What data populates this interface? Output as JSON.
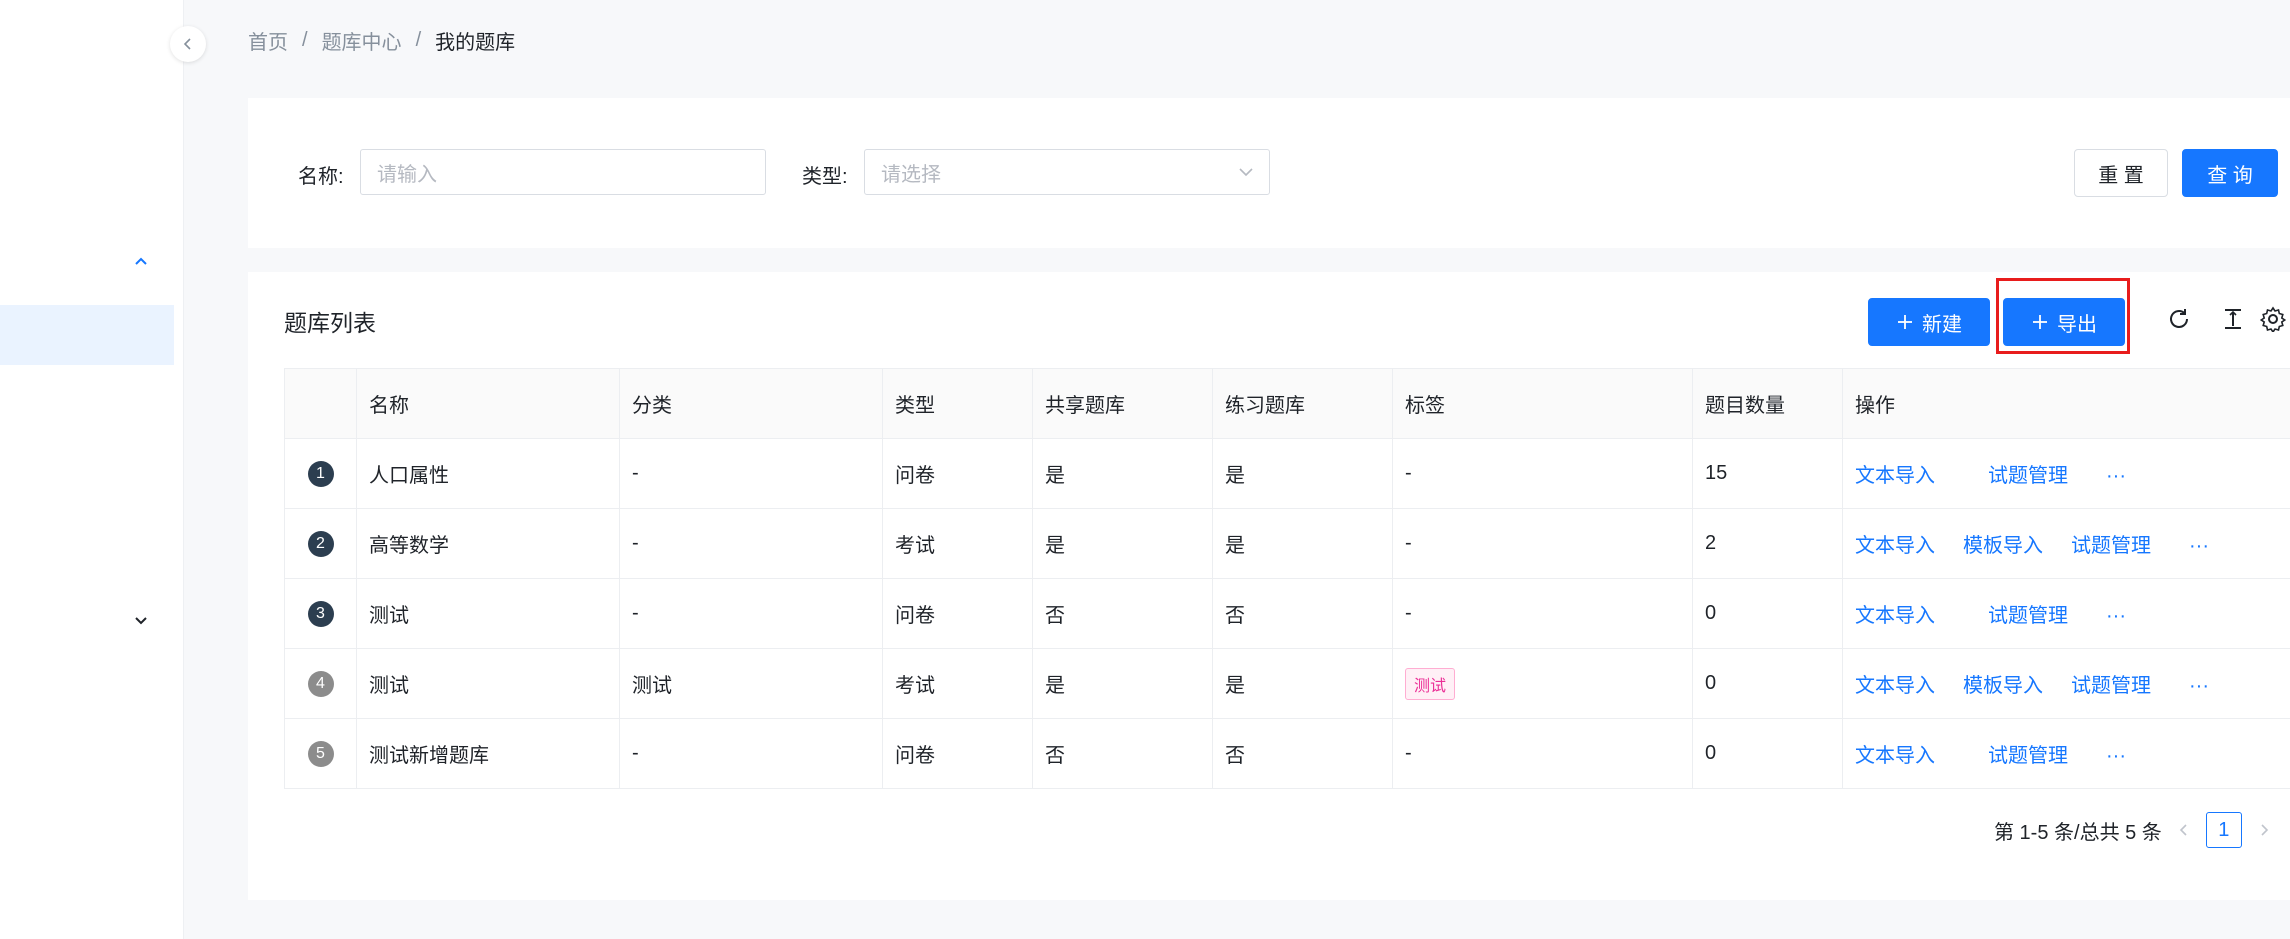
{
  "breadcrumb": {
    "home": "首页",
    "center": "题库中心",
    "current": "我的题库",
    "separator": "/"
  },
  "search": {
    "name_label": "名称:",
    "name_placeholder": "请输入",
    "type_label": "类型:",
    "type_placeholder": "请选择",
    "reset_label": "重 置",
    "query_label": "查 询"
  },
  "list": {
    "title": "题库列表",
    "new_label": "新建",
    "export_label": "导出",
    "columns": [
      "名称",
      "分类",
      "类型",
      "共享题库",
      "练习题库",
      "标签",
      "题目数量",
      "操作"
    ],
    "rows": [
      {
        "index": "1",
        "name": "人口属性",
        "category": "-",
        "type": "问卷",
        "shared": "是",
        "practice": "是",
        "tag": "-",
        "count": "15",
        "ops": [
          "文本导入",
          "试题管理"
        ]
      },
      {
        "index": "2",
        "name": "高等数学",
        "category": "-",
        "type": "考试",
        "shared": "是",
        "practice": "是",
        "tag": "-",
        "count": "2",
        "ops": [
          "文本导入",
          "模板导入",
          "试题管理"
        ]
      },
      {
        "index": "3",
        "name": "测试",
        "category": "-",
        "type": "问卷",
        "shared": "否",
        "practice": "否",
        "tag": "-",
        "count": "0",
        "ops": [
          "文本导入",
          "试题管理"
        ]
      },
      {
        "index": "4",
        "name": "测试",
        "category": "测试",
        "type": "考试",
        "shared": "是",
        "practice": "是",
        "tag": "测试",
        "count": "0",
        "ops": [
          "文本导入",
          "模板导入",
          "试题管理"
        ]
      },
      {
        "index": "5",
        "name": "测试新增题库",
        "category": "-",
        "type": "问卷",
        "shared": "否",
        "practice": "否",
        "tag": "-",
        "count": "0",
        "ops": [
          "文本导入",
          "试题管理"
        ]
      }
    ],
    "more_label": "···"
  },
  "pagination": {
    "summary": "第 1-5 条/总共 5 条",
    "current_page": "1"
  },
  "colors": {
    "primary": "#1677ff",
    "highlight": "#e81c1c",
    "tag": "#eb2f96"
  },
  "icons": [
    "collapse-left-icon",
    "chevron-up-icon",
    "chevron-down-icon",
    "plus-icon",
    "refresh-icon",
    "column-height-icon",
    "settings-icon"
  ]
}
